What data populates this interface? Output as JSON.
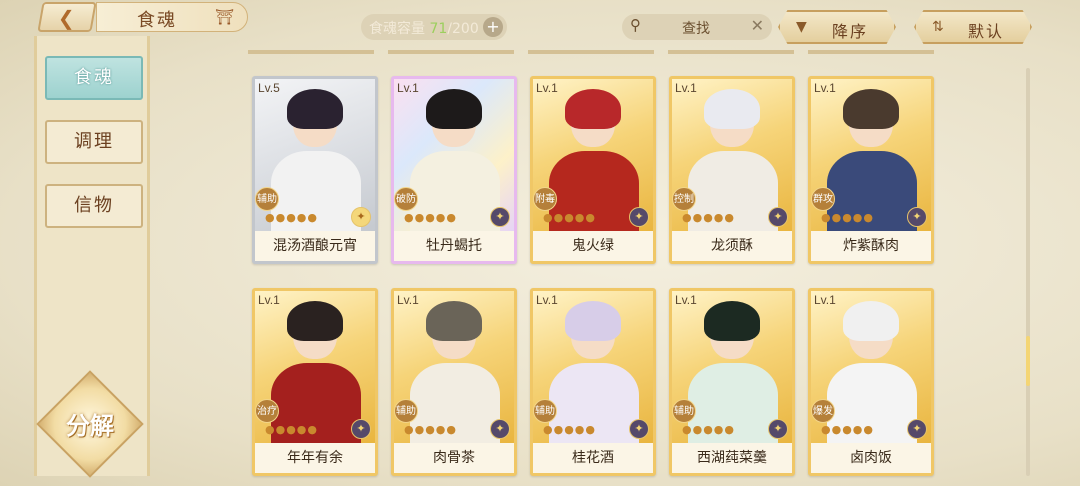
{
  "header": {
    "back_icon": "back-arrow-icon",
    "title": "食魂",
    "capacity_label": "食魂容量",
    "capacity_current": "71",
    "capacity_max": "/200",
    "add_label": "+",
    "search_placeholder": "查找",
    "clear_label": "✕",
    "sort_label": "降序",
    "default_label": "默认"
  },
  "sidebar": {
    "tabs": [
      {
        "label": "食魂",
        "active": true
      },
      {
        "label": "调理",
        "active": false
      },
      {
        "label": "信物",
        "active": false
      }
    ],
    "decompose_label": "分解"
  },
  "cards": [
    {
      "level": "Lv.5",
      "name": "混汤酒酿元宵",
      "role": "辅助",
      "frame": "silver"
    },
    {
      "level": "Lv.1",
      "name": "牡丹蝎托",
      "role": "破防",
      "frame": "rainbow"
    },
    {
      "level": "Lv.1",
      "name": "鬼火绿",
      "role": "附毒",
      "frame": "gold"
    },
    {
      "level": "Lv.1",
      "name": "龙须酥",
      "role": "控制",
      "frame": "gold"
    },
    {
      "level": "Lv.1",
      "name": "炸紫酥肉",
      "role": "群攻",
      "frame": "gold"
    },
    {
      "level": "Lv.1",
      "name": "年年有余",
      "role": "治疗",
      "frame": "gold"
    },
    {
      "level": "Lv.1",
      "name": "肉骨茶",
      "role": "辅助",
      "frame": "gold"
    },
    {
      "level": "Lv.1",
      "name": "桂花酒",
      "role": "辅助",
      "frame": "gold"
    },
    {
      "level": "Lv.1",
      "name": "西湖莼菜羹",
      "role": "辅助",
      "frame": "gold"
    },
    {
      "level": "Lv.1",
      "name": "卤肉饭",
      "role": "爆发",
      "frame": "gold"
    }
  ]
}
